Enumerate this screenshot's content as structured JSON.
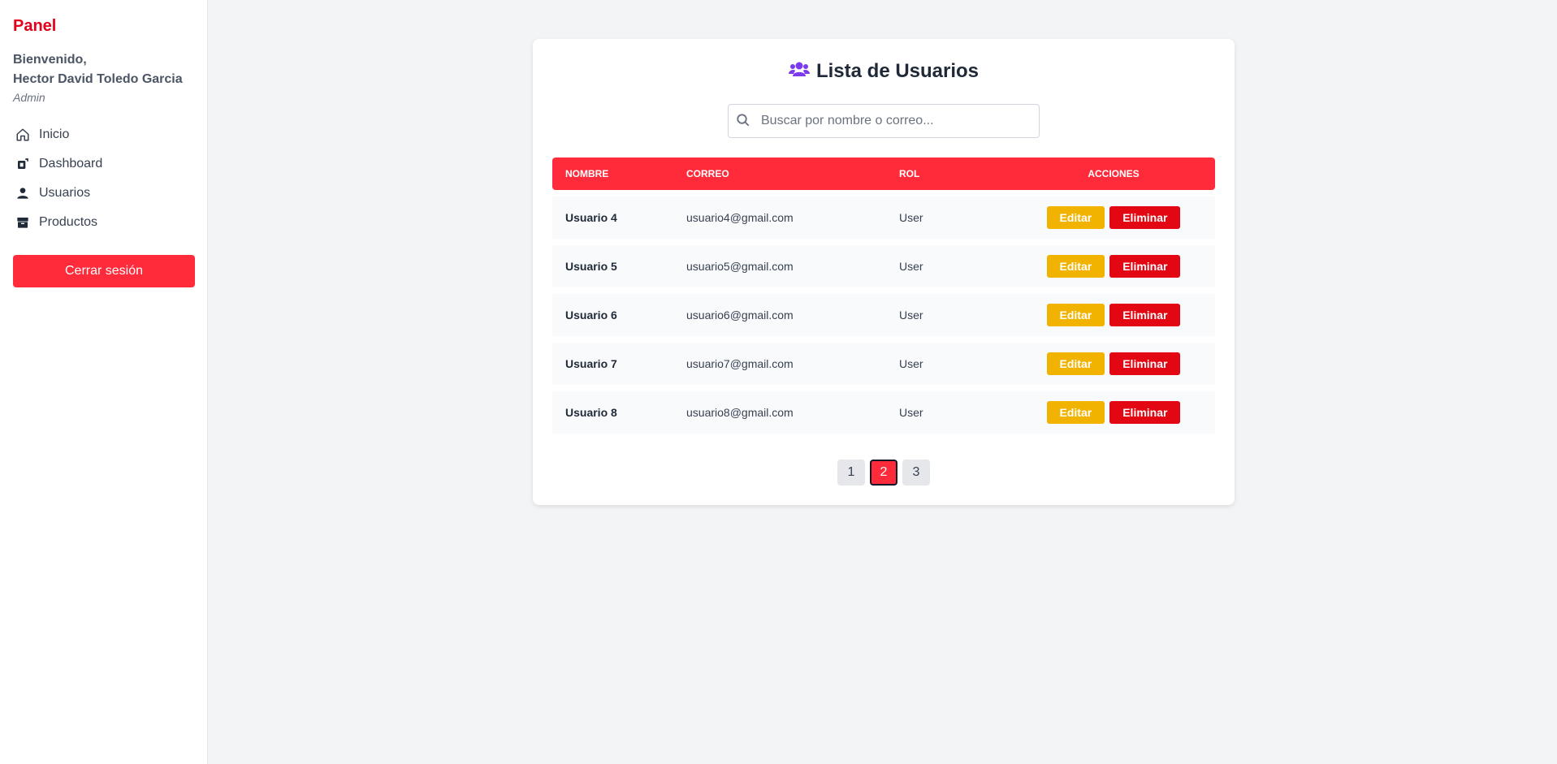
{
  "sidebar": {
    "brand": "Panel",
    "welcome": "Bienvenido,",
    "user_name": "Hector David Toledo Garcia",
    "role": "Admin",
    "nav": [
      {
        "label": "Inicio",
        "icon": "home-icon"
      },
      {
        "label": "Dashboard",
        "icon": "dashboard-icon"
      },
      {
        "label": "Usuarios",
        "icon": "user-icon"
      },
      {
        "label": "Productos",
        "icon": "box-icon"
      }
    ],
    "logout_label": "Cerrar sesión"
  },
  "main": {
    "title": "Lista de Usuarios",
    "title_icon": "users-icon",
    "search": {
      "placeholder": "Buscar por nombre o correo...",
      "value": ""
    },
    "table": {
      "headers": [
        "NOMBRE",
        "CORREO",
        "ROL",
        "ACCIONES"
      ],
      "rows": [
        {
          "name": "Usuario 4",
          "email": "usuario4@gmail.com",
          "role": "User"
        },
        {
          "name": "Usuario 5",
          "email": "usuario5@gmail.com",
          "role": "User"
        },
        {
          "name": "Usuario 6",
          "email": "usuario6@gmail.com",
          "role": "User"
        },
        {
          "name": "Usuario 7",
          "email": "usuario7@gmail.com",
          "role": "User"
        },
        {
          "name": "Usuario 8",
          "email": "usuario8@gmail.com",
          "role": "User"
        }
      ],
      "edit_label": "Editar",
      "delete_label": "Eliminar"
    },
    "pagination": {
      "pages": [
        "1",
        "2",
        "3"
      ],
      "current": "2"
    }
  },
  "colors": {
    "brand": "#e3001b",
    "header_red": "#ff2b3a",
    "edit_yellow": "#f2b300",
    "delete_red": "#e30613",
    "title_icon_purple": "#7c3aed"
  }
}
